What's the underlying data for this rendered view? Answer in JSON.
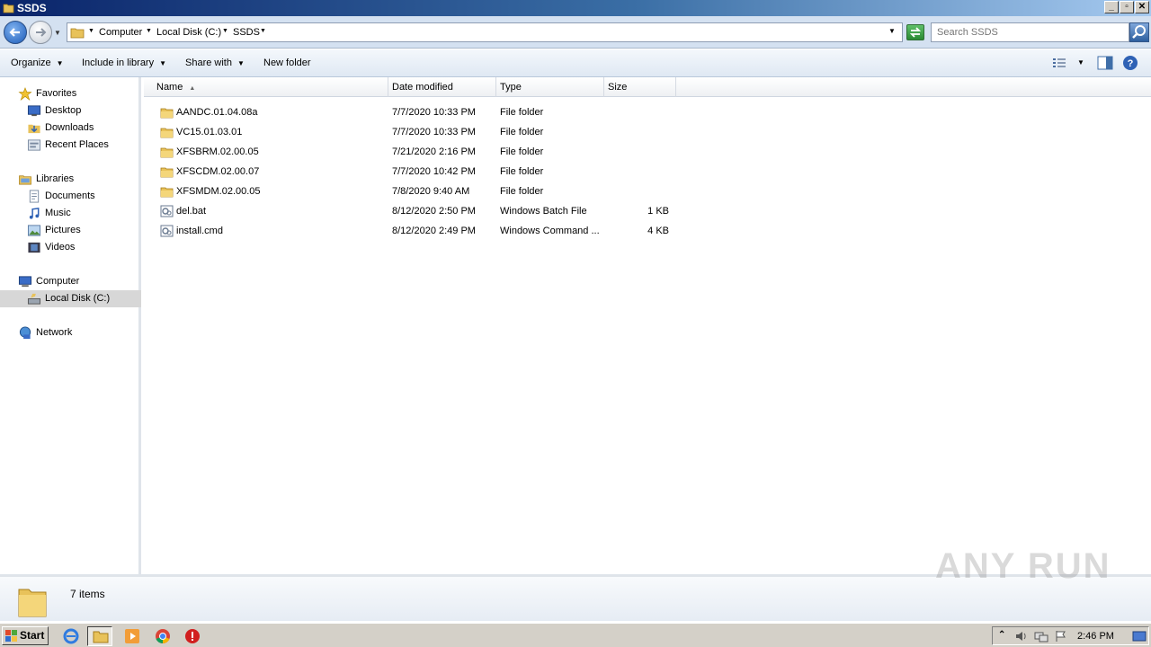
{
  "window": {
    "title": "SSDS"
  },
  "address": {
    "crumbs": [
      "Computer",
      "Local Disk (C:)",
      "SSDS"
    ],
    "search_placeholder": "Search SSDS"
  },
  "toolbar": {
    "organize": "Organize",
    "include_in_library": "Include in library",
    "share_with": "Share with",
    "new_folder": "New folder"
  },
  "nav": {
    "favorites": "Favorites",
    "desktop": "Desktop",
    "downloads": "Downloads",
    "recent_places": "Recent Places",
    "libraries": "Libraries",
    "documents": "Documents",
    "music": "Music",
    "pictures": "Pictures",
    "videos": "Videos",
    "computer": "Computer",
    "local_disk": "Local Disk (C:)",
    "network": "Network"
  },
  "columns": {
    "name": "Name",
    "date_modified": "Date modified",
    "type": "Type",
    "size": "Size"
  },
  "files": [
    {
      "name": "AANDC.01.04.08a",
      "date": "7/7/2020 10:33 PM",
      "type": "File folder",
      "size": "",
      "icon": "folder-icon"
    },
    {
      "name": "VC15.01.03.01",
      "date": "7/7/2020 10:33 PM",
      "type": "File folder",
      "size": "",
      "icon": "folder-icon"
    },
    {
      "name": "XFSBRM.02.00.05",
      "date": "7/21/2020 2:16 PM",
      "type": "File folder",
      "size": "",
      "icon": "folder-icon"
    },
    {
      "name": "XFSCDM.02.00.07",
      "date": "7/7/2020 10:42 PM",
      "type": "File folder",
      "size": "",
      "icon": "folder-icon"
    },
    {
      "name": "XFSMDM.02.00.05",
      "date": "7/8/2020 9:40 AM",
      "type": "File folder",
      "size": "",
      "icon": "folder-icon"
    },
    {
      "name": "del.bat",
      "date": "8/12/2020 2:50 PM",
      "type": "Windows Batch File",
      "size": "1 KB",
      "icon": "batch-file-icon"
    },
    {
      "name": "install.cmd",
      "date": "8/12/2020 2:49 PM",
      "type": "Windows Command ...",
      "size": "4 KB",
      "icon": "batch-file-icon"
    }
  ],
  "status": {
    "item_count": "7 items"
  },
  "watermark": "ANY RUN",
  "taskbar": {
    "start": "Start",
    "clock": "2:46 PM"
  },
  "colors": {
    "titlebar_start": "#0a246a",
    "titlebar_end": "#a6caf0",
    "nav_selected": "#d7d7d7",
    "folder": "#e8c25a"
  }
}
